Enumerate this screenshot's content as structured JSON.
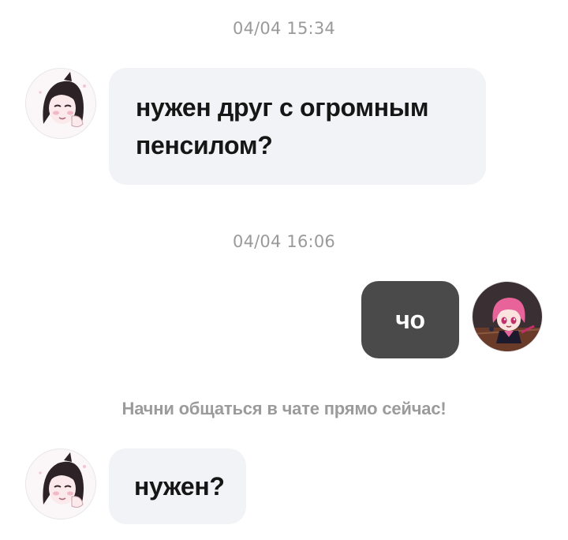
{
  "chat": {
    "messages": [
      {
        "time": "04/04 15:34",
        "sender": "other",
        "text": "нужен друг с огромным пенсилом?"
      },
      {
        "time": "04/04 16:06",
        "sender": "me",
        "text": "чо"
      },
      {
        "sender": "other",
        "text": "нужен?"
      }
    ],
    "hint": "Начни общаться в чате прямо сейчас!"
  },
  "colors": {
    "incoming_bubble": "#f2f3f6",
    "outgoing_bubble": "#4a4a4a",
    "timestamp": "#9a9a9a",
    "hint": "#9b9b9b"
  },
  "icons": {
    "other_avatar": "anime-boy-avatar-icon",
    "my_avatar": "anime-girl-avatar-icon"
  }
}
